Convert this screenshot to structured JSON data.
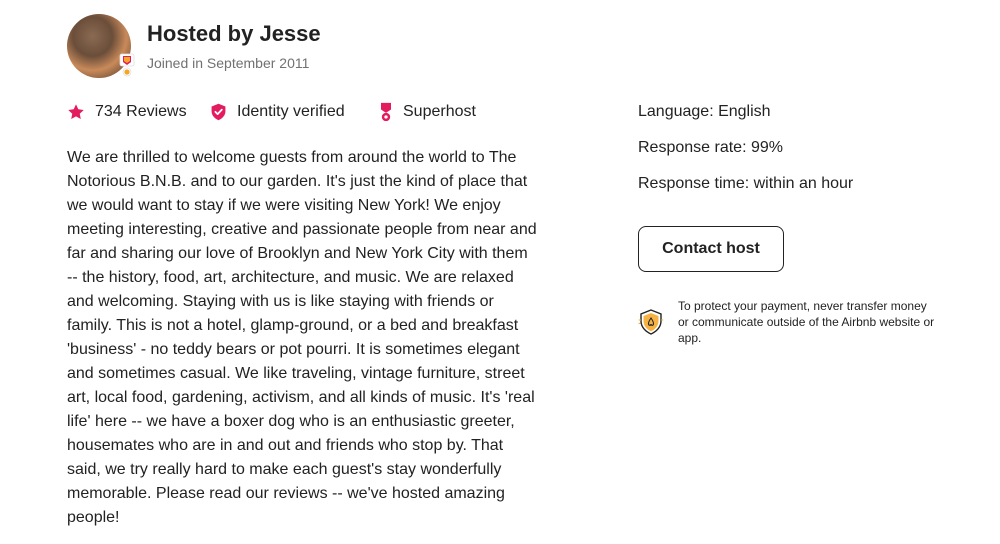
{
  "host": {
    "name_title": "Hosted by Jesse",
    "joined": "Joined in September 2011",
    "avatar_icon": "host-avatar",
    "badge_icon": "superhost-badge-icon"
  },
  "stats": [
    {
      "icon": "star-icon",
      "label": "734 Reviews",
      "color": "#E31C5F"
    },
    {
      "icon": "verified-shield-icon",
      "label": "Identity verified",
      "color": "#E31C5F"
    },
    {
      "icon": "superhost-medal-icon",
      "label": "Superhost",
      "color": "#E31C5F"
    }
  ],
  "about": "We are thrilled to welcome guests from around the world to The Notorious B.N.B. and to our garden. It's just the kind of place that we would want to stay if we were visiting New York! We enjoy meeting interesting, creative and passionate people from near and far and sharing our love of Brooklyn and New York City with them -- the history, food, art, architecture, and music. We are relaxed and welcoming. Staying with us is like staying with friends or family. This is not a hotel, glamp-ground, or a bed and breakfast 'business' - no teddy bears or pot pourri. It is sometimes elegant and sometimes casual. We like traveling, vintage furniture, street art, local food, gardening, activism, and all kinds of music. It's 'real life' here -- we have a boxer dog who is an enthusiastic greeter, housemates who are in and out and friends who stop by. That said, we try really hard to make each guest's stay wonderfully memorable. Please read our reviews -- we've hosted amazing people!",
  "info": {
    "language": "Language: English",
    "response_rate": "Response rate: 99%",
    "response_time": "Response time: within an hour"
  },
  "contact_button": "Contact host",
  "protection_notice": {
    "icon": "payment-protection-shield-icon",
    "text": "To protect your payment, never transfer money or communicate outside of the Airbnb website or app."
  },
  "colors": {
    "accent": "#E31C5F",
    "text": "#222222",
    "muted": "#717171",
    "shield_orange": "#F5A623"
  }
}
